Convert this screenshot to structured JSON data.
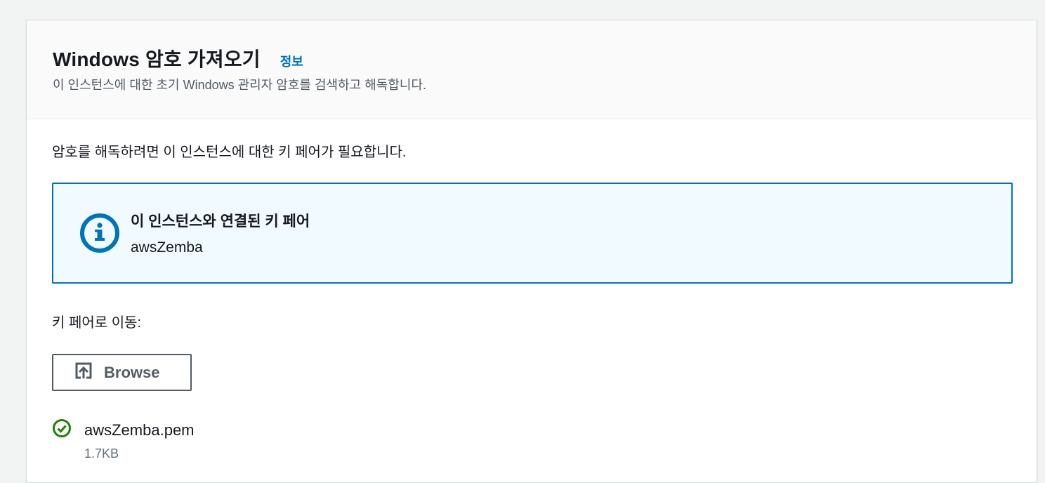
{
  "header": {
    "title": "Windows 암호 가져오기",
    "info_link": "정보",
    "subtitle": "이 인스턴스에 대한 초기 Windows 관리자 암호를 검색하고 해독합니다."
  },
  "body": {
    "description": "암호를 해독하려면 이 인스턴스에 대한 키 페어가 필요합니다.",
    "alert": {
      "icon": "info-icon",
      "title": "이 인스턴스와 연결된 키 페어",
      "value": "awsZemba"
    },
    "navigate_label": "키 페어로 이동:",
    "browse_button": {
      "icon": "upload-icon",
      "label": "Browse"
    },
    "file": {
      "icon": "check-circle-icon",
      "name": "awsZemba.pem",
      "size": "1.7KB"
    }
  },
  "colors": {
    "link": "#0073bb",
    "alert_border": "#0073bb",
    "alert_bg": "#f1faff",
    "success": "#1d8102",
    "button_text": "#545b64"
  }
}
